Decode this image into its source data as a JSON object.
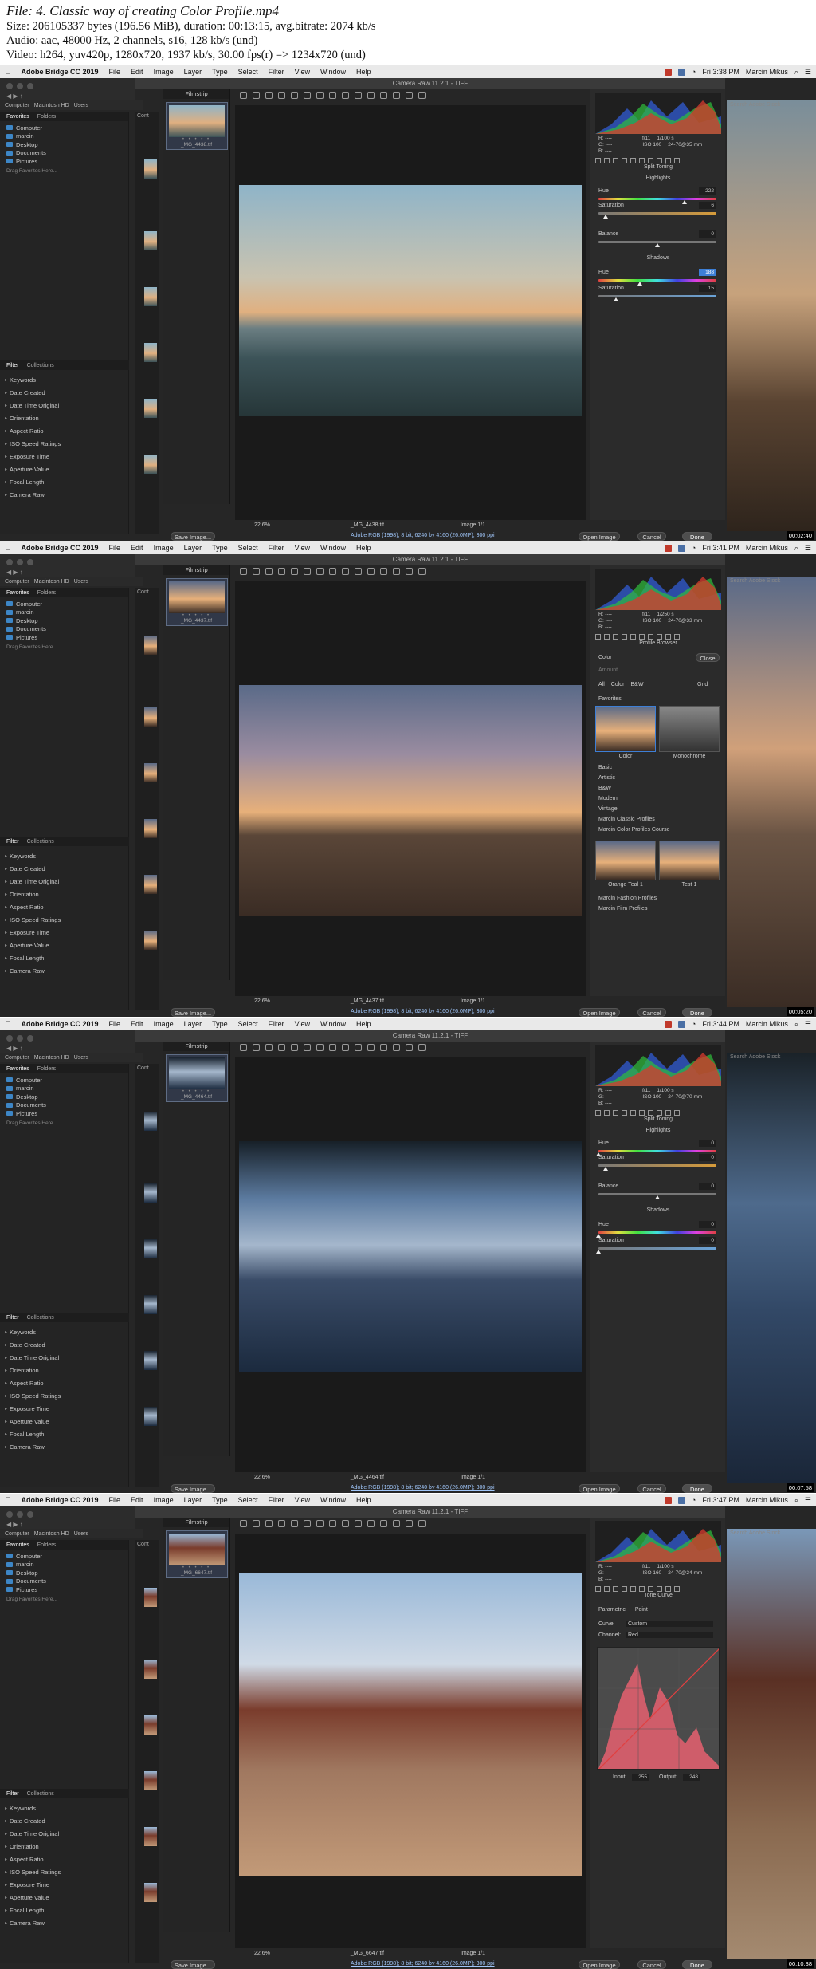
{
  "file_info": {
    "lines": [
      "File: 4. Classic way of creating Color Profile.mp4",
      "Size: 206105337 bytes (196.56 MiB), duration: 00:13:15, avg.bitrate: 2074 kb/s",
      "Audio: aac, 48000 Hz, 2 channels, s16, 128 kb/s (und)",
      "Video: h264, yuv420p, 1280x720, 1937 kb/s, 30.00 fps(r) => 1234x720 (und)"
    ]
  },
  "menubar": {
    "app": "Adobe Bridge CC 2019",
    "items": [
      "File",
      "Edit",
      "Image",
      "Layer",
      "Type",
      "Select",
      "Filter",
      "View",
      "Window",
      "Help"
    ],
    "user": "Marcin Mikus"
  },
  "dialog": {
    "title": "Camera Raw 11.2.1 - TIFF",
    "save_label": "Save Image...",
    "open_label": "Open Image",
    "cancel_label": "Cancel",
    "done_label": "Done",
    "zoom": "22.6%",
    "image_count": "Image 1/1",
    "workflow": "Adobe RGB (1998); 8 bit; 6240 by 4160 (26.0MP); 300 ppi"
  },
  "bridge": {
    "path": [
      "Computer",
      "Macintosh HD",
      "Users"
    ],
    "tabs_top": [
      "Favorites",
      "Folders"
    ],
    "favorites": [
      "Computer",
      "marcin",
      "Desktop",
      "Documents",
      "Pictures"
    ],
    "drag_hint": "Drag Favorites Here...",
    "tabs_bottom": [
      "Filter",
      "Collections"
    ],
    "filters": [
      "Keywords",
      "Date Created",
      "Date Time Original",
      "Orientation",
      "Aspect Ratio",
      "ISO Speed Ratings",
      "Exposure Time",
      "Aperture Value",
      "Focal Length",
      "Camera Raw"
    ],
    "content_label": "Cont",
    "search_placeholder": "Search Adobe Stock"
  },
  "frames": [
    {
      "time": "Fri 3:38 PM",
      "filename": "_MG_4438.tif",
      "exif": {
        "rgb": [
          "R: ----",
          "G: ----",
          "B: ----"
        ],
        "f": "f/11",
        "shutter": "1/100 s",
        "iso": "ISO 100",
        "lens": "24-70@35 mm"
      },
      "panel": "split",
      "section_title": "Split Toning",
      "highlights_label": "Highlights",
      "hue_label": "Hue",
      "saturation_label": "Saturation",
      "balance_label": "Balance",
      "shadows_label": "Shadows",
      "hl_hue": "222",
      "hl_sat": "6",
      "balance": "0",
      "sh_hue": "188",
      "sh_sat": "15",
      "timestamp": "00:02:40"
    },
    {
      "time": "Fri 3:41 PM",
      "filename": "_MG_4437.tif",
      "exif": {
        "rgb": [
          "R: ----",
          "G: ----",
          "B: ----"
        ],
        "f": "f/11",
        "shutter": "1/250 s",
        "iso": "ISO 100",
        "lens": "24-70@33 mm"
      },
      "panel": "profile",
      "section_title": "Profile Browser",
      "color_label": "Color",
      "close_label": "Close",
      "amount_label": "Amount",
      "filter_opts": [
        "All",
        "Color",
        "B&W"
      ],
      "grid_label": "Grid",
      "favorites_label": "Favorites",
      "fav_profiles": [
        "Color",
        "Monochrome"
      ],
      "groups": [
        "Basic",
        "Artistic",
        "B&W",
        "Modern",
        "Vintage",
        "Marcin Classic Profiles",
        "Marcin Color Profiles Course"
      ],
      "course_profiles": [
        "Orange Teal 1",
        "Test 1"
      ],
      "groups_after": [
        "Marcin Fashion Profiles",
        "Marcin Film Profiles"
      ],
      "timestamp": "00:05:20"
    },
    {
      "time": "Fri 3:44 PM",
      "filename": "_MG_4464.tif",
      "exif": {
        "rgb": [
          "R: ----",
          "G: ----",
          "B: ----"
        ],
        "f": "f/11",
        "shutter": "1/100 s",
        "iso": "ISO 100",
        "lens": "24-70@70 mm"
      },
      "panel": "split",
      "section_title": "Split Toning",
      "highlights_label": "Highlights",
      "hue_label": "Hue",
      "saturation_label": "Saturation",
      "balance_label": "Balance",
      "shadows_label": "Shadows",
      "hl_hue": "0",
      "hl_sat": "0",
      "balance": "0",
      "sh_hue": "0",
      "sh_sat": "0",
      "timestamp": "00:07:58"
    },
    {
      "time": "Fri 3:47 PM",
      "filename": "_MG_6647.tif",
      "exif": {
        "rgb": [
          "R: ----",
          "G: ----",
          "B: ----"
        ],
        "f": "f/11",
        "shutter": "1/100 s",
        "iso": "ISO 160",
        "lens": "24-70@24 mm"
      },
      "panel": "curve",
      "section_title": "Tone Curve",
      "curve_tabs": [
        "Parametric",
        "Point"
      ],
      "curve_label": "Curve:",
      "curve_value": "Custom",
      "channel_label": "Channel:",
      "channel_value": "Red",
      "input_label": "Input:",
      "input_value": "255",
      "output_label": "Output:",
      "output_value": "248",
      "timestamp": "00:10:38"
    }
  ],
  "colors": {
    "accent": "#3d7fd6",
    "panel": "#2b2b2b",
    "folder": "#3d86c6"
  }
}
